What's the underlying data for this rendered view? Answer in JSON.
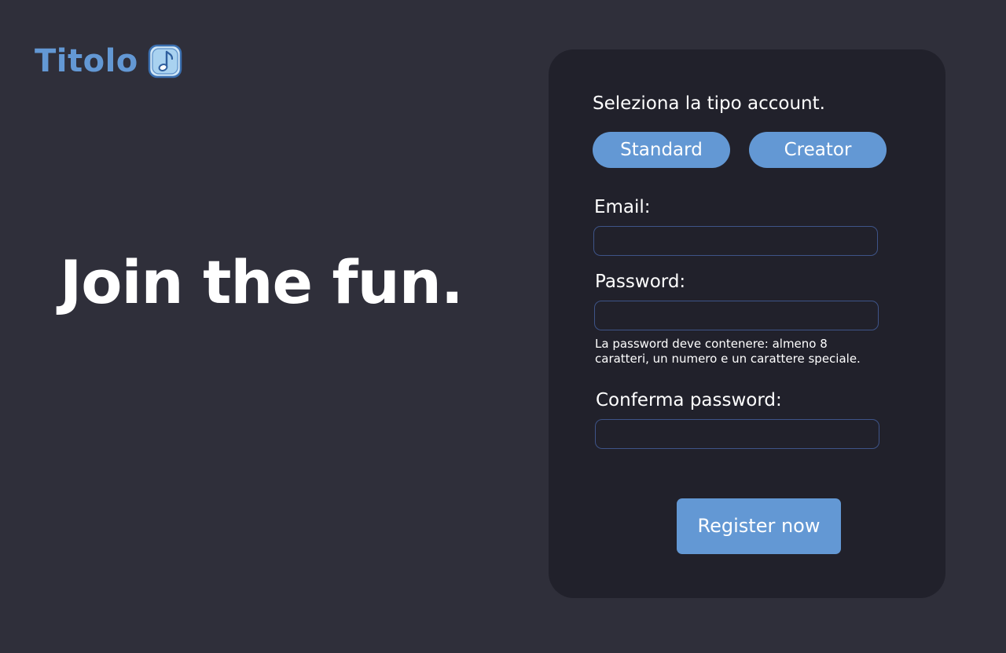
{
  "brand": {
    "name": "Titolo",
    "icon": "music-note-icon",
    "color": "#6398d4"
  },
  "hero": {
    "headline": "Join the fun."
  },
  "form": {
    "account_type_label": "Seleziona la tipo account.",
    "account_types": [
      "Standard",
      "Creator"
    ],
    "email_label": "Email:",
    "email_value": "",
    "password_label": "Password:",
    "password_value": "",
    "password_hint": "La password deve contenere: almeno 8 caratteri, un numero e un carattere speciale.",
    "confirm_label": "Conferma password:",
    "confirm_value": "",
    "submit_label": "Register now"
  },
  "colors": {
    "background": "#2f2f3a",
    "card": "#21212b",
    "accent": "#6398d4",
    "input_border": "#3e5488",
    "text": "#ffffff"
  }
}
